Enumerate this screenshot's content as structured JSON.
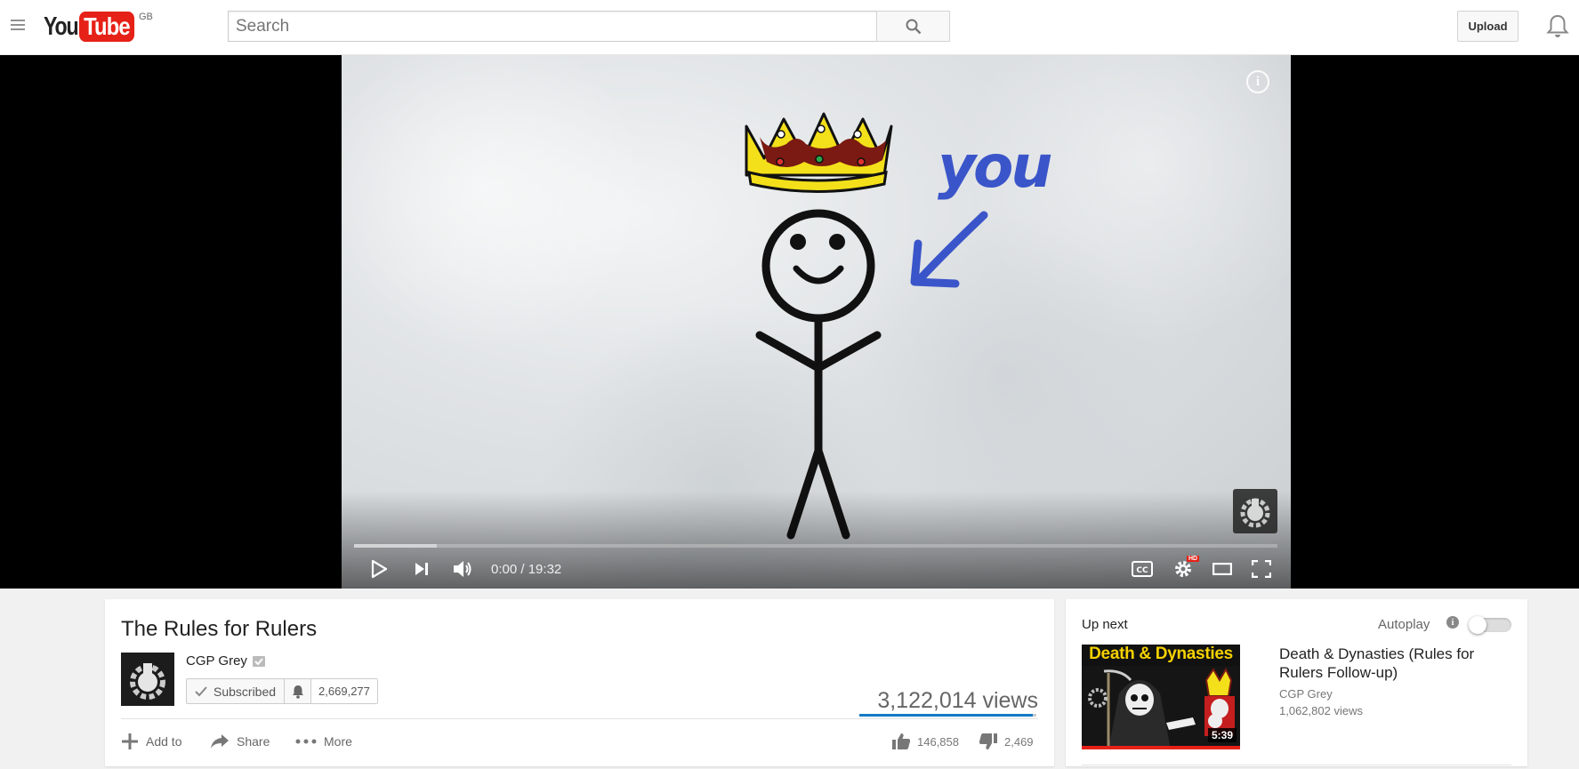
{
  "masthead": {
    "logo_text_1": "You",
    "logo_text_2": "Tube",
    "region": "GB",
    "search_placeholder": "Search",
    "upload_label": "Upload"
  },
  "player": {
    "annotation_word": "you",
    "current_time": "0:00",
    "time_separator": " / ",
    "duration": "19:32",
    "buffer_fraction": 0.09,
    "hd_badge": "HD"
  },
  "video": {
    "title": "The Rules for Rulers",
    "channel_name": "CGP Grey",
    "subscribe_label": "Subscribed",
    "subscriber_count": "2,669,277",
    "views": "3,122,014 views",
    "like_fraction": 0.98,
    "actions": {
      "add_to": "Add to",
      "share": "Share",
      "more": "More"
    },
    "likes": "146,858",
    "dislikes": "2,469"
  },
  "sidebar": {
    "up_next": "Up next",
    "autoplay": "Autoplay",
    "autoplay_info": "i",
    "next_video": {
      "thumb_title": "Death & Dynasties",
      "duration": "5:39",
      "title": "Death & Dynasties (Rules for Rulers Follow-up)",
      "channel": "CGP Grey",
      "views": "1,062,802 views"
    }
  },
  "colors": {
    "brand_red": "#e62117",
    "like_blue": "#167ac6",
    "crown_yellow": "#f3e01a",
    "crown_red": "#7a1a12",
    "arrow_blue": "#3a55c9"
  }
}
